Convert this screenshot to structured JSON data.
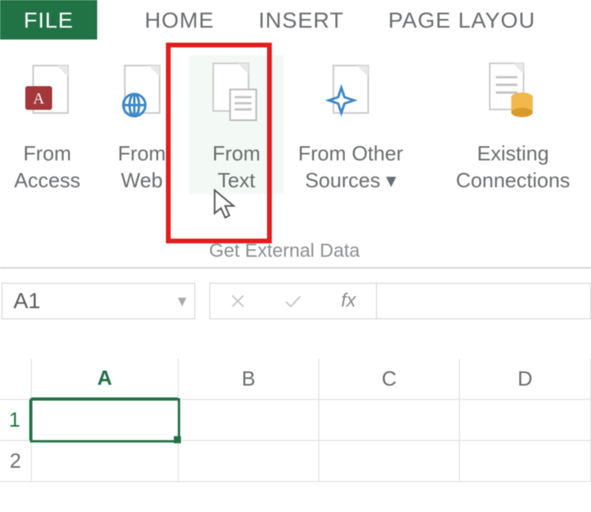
{
  "tabs": {
    "file": "FILE",
    "home": "HOME",
    "insert": "INSERT",
    "pagelayout": "PAGE LAYOU"
  },
  "ribbon": {
    "fromAccess": "From\nAccess",
    "fromWeb": "From\nWeb",
    "fromText": "From\nText",
    "fromOther": "From Other\nSources ▾",
    "existingConn": "Existing\nConnections",
    "groupCaption": "Get External Data"
  },
  "namebox": {
    "value": "A1",
    "dropdown": "▾"
  },
  "fx": {
    "label": "fx"
  },
  "columns": {
    "a": "A",
    "b": "B",
    "c": "C",
    "d": "D"
  },
  "rows": {
    "r1": "1",
    "r2": "2"
  }
}
